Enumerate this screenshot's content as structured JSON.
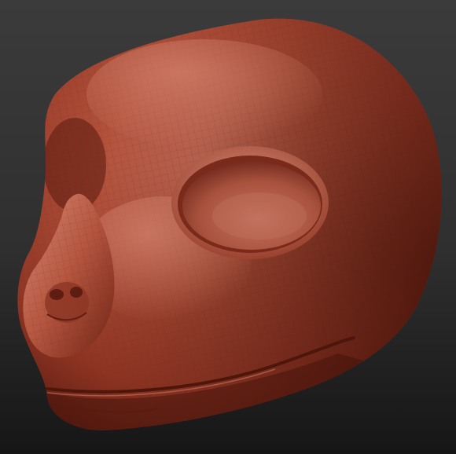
{
  "scene": {
    "subject": "sculpted-head-model",
    "background_top_color": "#3b3b3b",
    "background_bottom_color": "#161616",
    "material_base_color": "#a5432e",
    "material_highlight_color": "#d9826a",
    "material_shadow_color": "#4a150c",
    "wireframe_color": "#7a2c1c"
  }
}
